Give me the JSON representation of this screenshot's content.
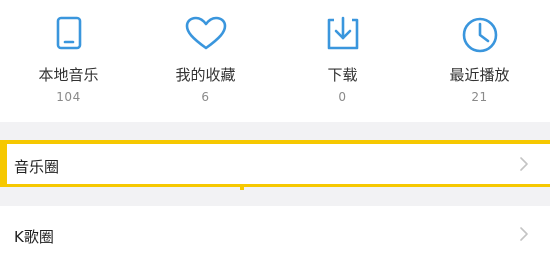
{
  "shortcuts": [
    {
      "label": "本地音乐",
      "count": "104",
      "icon": "tablet-icon"
    },
    {
      "label": "我的收藏",
      "count": "6",
      "icon": "heart-icon"
    },
    {
      "label": "下载",
      "count": "0",
      "icon": "download-icon"
    },
    {
      "label": "最近播放",
      "count": "21",
      "icon": "clock-icon"
    }
  ],
  "list": {
    "music_circle": {
      "label": "音乐圈",
      "icon": "chevron-right-icon"
    },
    "k_song": {
      "label": "K歌圈",
      "icon": "chevron-right-icon"
    }
  },
  "colors": {
    "accent": "#3a96dd",
    "highlight": "#f6c800",
    "background": "#f2f2f4"
  }
}
